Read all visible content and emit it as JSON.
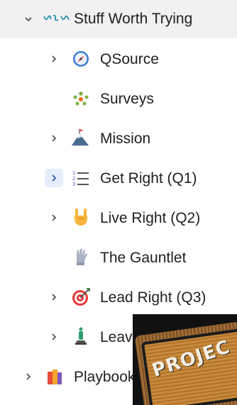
{
  "tree": {
    "root": {
      "icon": "ink-glyph-icon",
      "label": "Stuff Worth Trying"
    },
    "items": [
      {
        "label": "QSource",
        "icon": "compass-icon",
        "expandable": true
      },
      {
        "label": "Surveys",
        "icon": "people-group-icon",
        "expandable": false
      },
      {
        "label": "Mission",
        "icon": "mountain-flag-icon",
        "expandable": true
      },
      {
        "label": "Get Right (Q1)",
        "icon": "numbered-list-icon",
        "expandable": true,
        "hovered": true
      },
      {
        "label": "Live Right (Q2)",
        "icon": "rock-hand-icon",
        "expandable": true
      },
      {
        "label": "The Gauntlet",
        "icon": "gauntlet-glove-icon",
        "expandable": false
      },
      {
        "label": "Lead Right (Q3)",
        "icon": "target-icon",
        "expandable": true
      },
      {
        "label": "Leav",
        "icon": "statue-icon",
        "expandable": true
      }
    ],
    "sibling": {
      "label": "Playbook",
      "icon": "books-icon",
      "expandable": true
    }
  },
  "overlay": {
    "patch_text": "PROJEC"
  },
  "colors": {
    "header_bg": "#f1f1f2",
    "hover_bg": "#e6eefb",
    "text": "#202124"
  }
}
